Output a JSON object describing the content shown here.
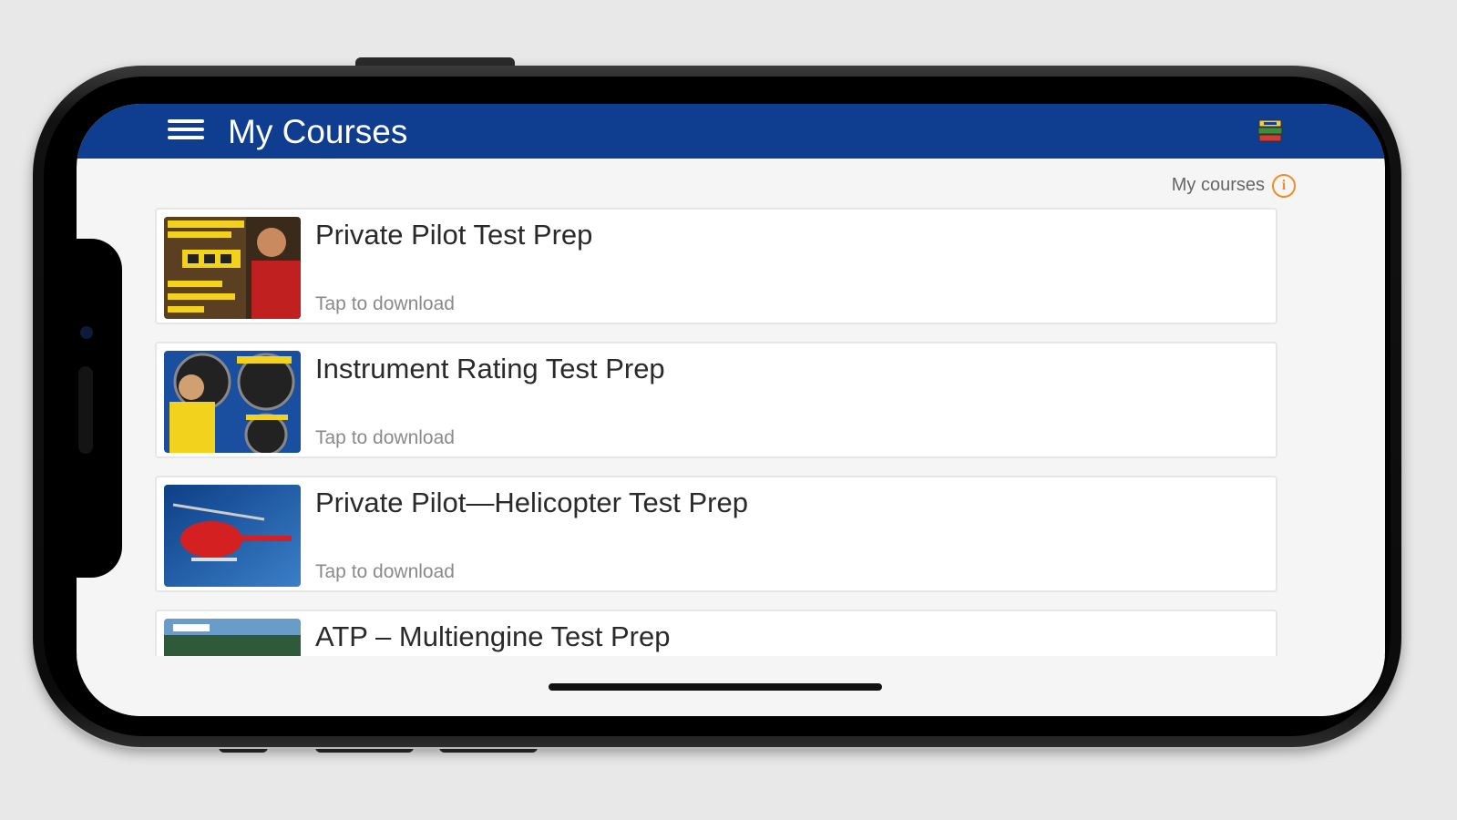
{
  "appbar": {
    "title": "My Courses",
    "menu_icon": "hamburger-menu-icon",
    "right_icon": "book-stack-icon",
    "color": "#0f3d8f"
  },
  "section": {
    "label": "My courses",
    "info_icon": "info-icon",
    "accent": "#f28c28"
  },
  "courses": [
    {
      "title": "Private Pilot Test Prep",
      "subtitle": "Tap to download"
    },
    {
      "title": "Instrument Rating Test Prep",
      "subtitle": "Tap to download"
    },
    {
      "title": "Private Pilot—Helicopter Test Prep",
      "subtitle": "Tap to download"
    },
    {
      "title": "ATP – Multiengine Test Prep",
      "subtitle": ""
    }
  ]
}
